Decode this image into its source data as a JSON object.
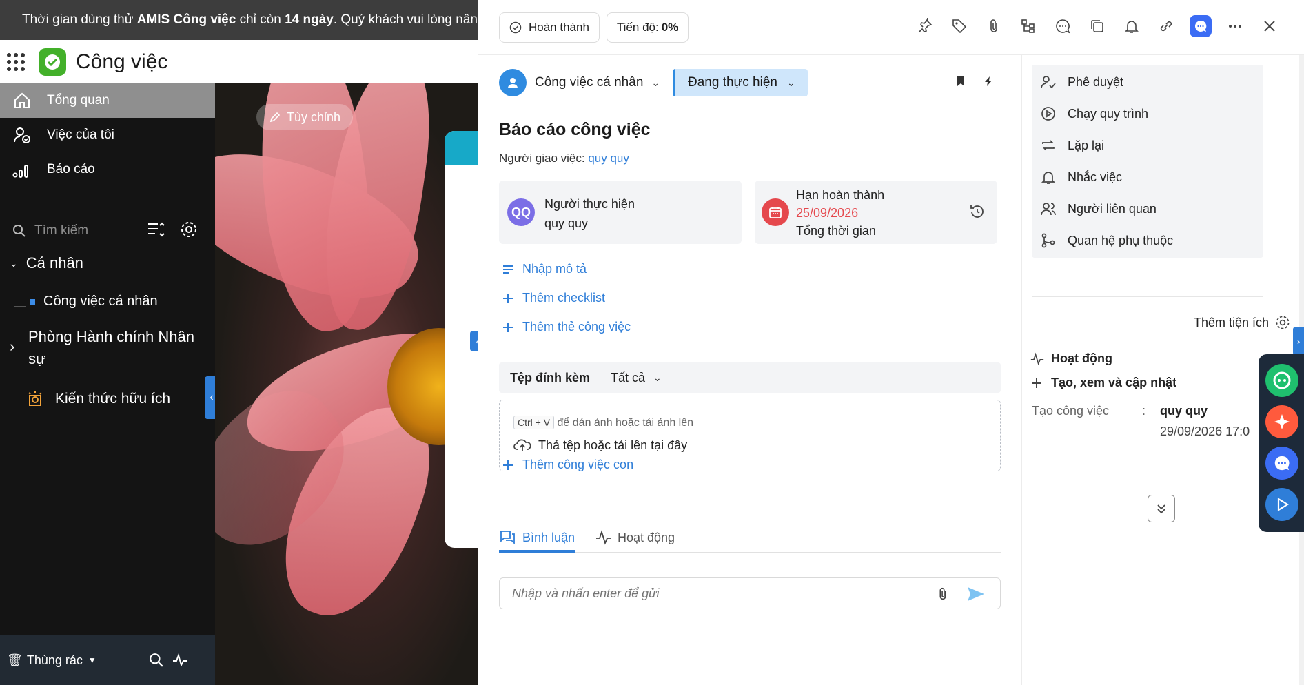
{
  "trial_banner": {
    "text_before": "Thời gian dùng thử ",
    "product": "AMIS Công việc",
    "text_mid": " chỉ còn ",
    "days": "14 ngày",
    "text_after": ". Quý khách vui lòng nâng c"
  },
  "app": {
    "title": "Công việc"
  },
  "sidebar": {
    "items": [
      {
        "label": "Tổng quan",
        "icon": "home-icon",
        "active": true
      },
      {
        "label": "Việc của tôi",
        "icon": "user-task-icon",
        "active": false
      },
      {
        "label": "Báo cáo",
        "icon": "report-bars-icon",
        "active": false
      }
    ],
    "search_placeholder": "Tìm kiếm",
    "tree": {
      "personal": "Cá nhân",
      "personal_child": "Công việc cá nhân",
      "department": "Phòng Hành chính Nhân sự",
      "knowledge": "Kiến thức hữu ích"
    },
    "footer": {
      "trash": "Thùng rác"
    }
  },
  "background": {
    "customize_label": "Tùy chỉnh"
  },
  "drawer": {
    "complete_label": "Hoàn thành",
    "progress_prefix": "Tiến độ: ",
    "progress_value": "0%",
    "project_label": "Công việc cá nhân",
    "status_label": "Đang thực hiện",
    "task_title": "Báo cáo công việc",
    "assigner_label": "Người giao việc: ",
    "assigner_name": "quy quy",
    "assignee": {
      "initials": "QQ",
      "label": "Người thực hiện",
      "name": "quy quy"
    },
    "deadline": {
      "label": "Hạn hoàn thành",
      "date": "25/09/2026",
      "total_time_label": "Tổng thời gian"
    },
    "actions": {
      "description": "Nhập mô tả",
      "checklist": "Thêm checklist",
      "tag": "Thêm thẻ công việc",
      "subtask": "Thêm công việc con"
    },
    "attachments": {
      "title": "Tệp đính kèm",
      "filter": "Tất cả",
      "shortcut": "Ctrl + V",
      "paste_hint": " để dán ảnh hoặc tải ảnh lên",
      "drop_hint": "Thả tệp hoặc tải lên tại đây"
    },
    "tabs": {
      "comments": "Bình luận",
      "activity": "Hoạt động"
    },
    "comment_placeholder": "Nhập và nhấn enter để gửi"
  },
  "utilities": {
    "items": [
      {
        "label": "Phê duyệt",
        "icon": "approval-icon"
      },
      {
        "label": "Chạy quy trình",
        "icon": "play-circle-icon"
      },
      {
        "label": "Lặp lại",
        "icon": "repeat-icon"
      },
      {
        "label": "Nhắc việc",
        "icon": "bell-icon"
      },
      {
        "label": "Người liên quan",
        "icon": "users-icon"
      },
      {
        "label": "Quan hệ phụ thuộc",
        "icon": "dependency-icon"
      }
    ],
    "add_label": "Thêm tiện ích"
  },
  "activity": {
    "title": "Hoạt động",
    "create_label": "Tạo, xem và cập nhật",
    "log_action": "Tạo công việc",
    "log_colon": ":",
    "log_user": "quy quy",
    "log_time": "29/09/2026 17:0"
  },
  "colors": {
    "accent": "#2f7ed8",
    "status_bg": "#cfe6fb",
    "deadline_red": "#e5484d",
    "avatar_purple": "#7b6ee6"
  }
}
